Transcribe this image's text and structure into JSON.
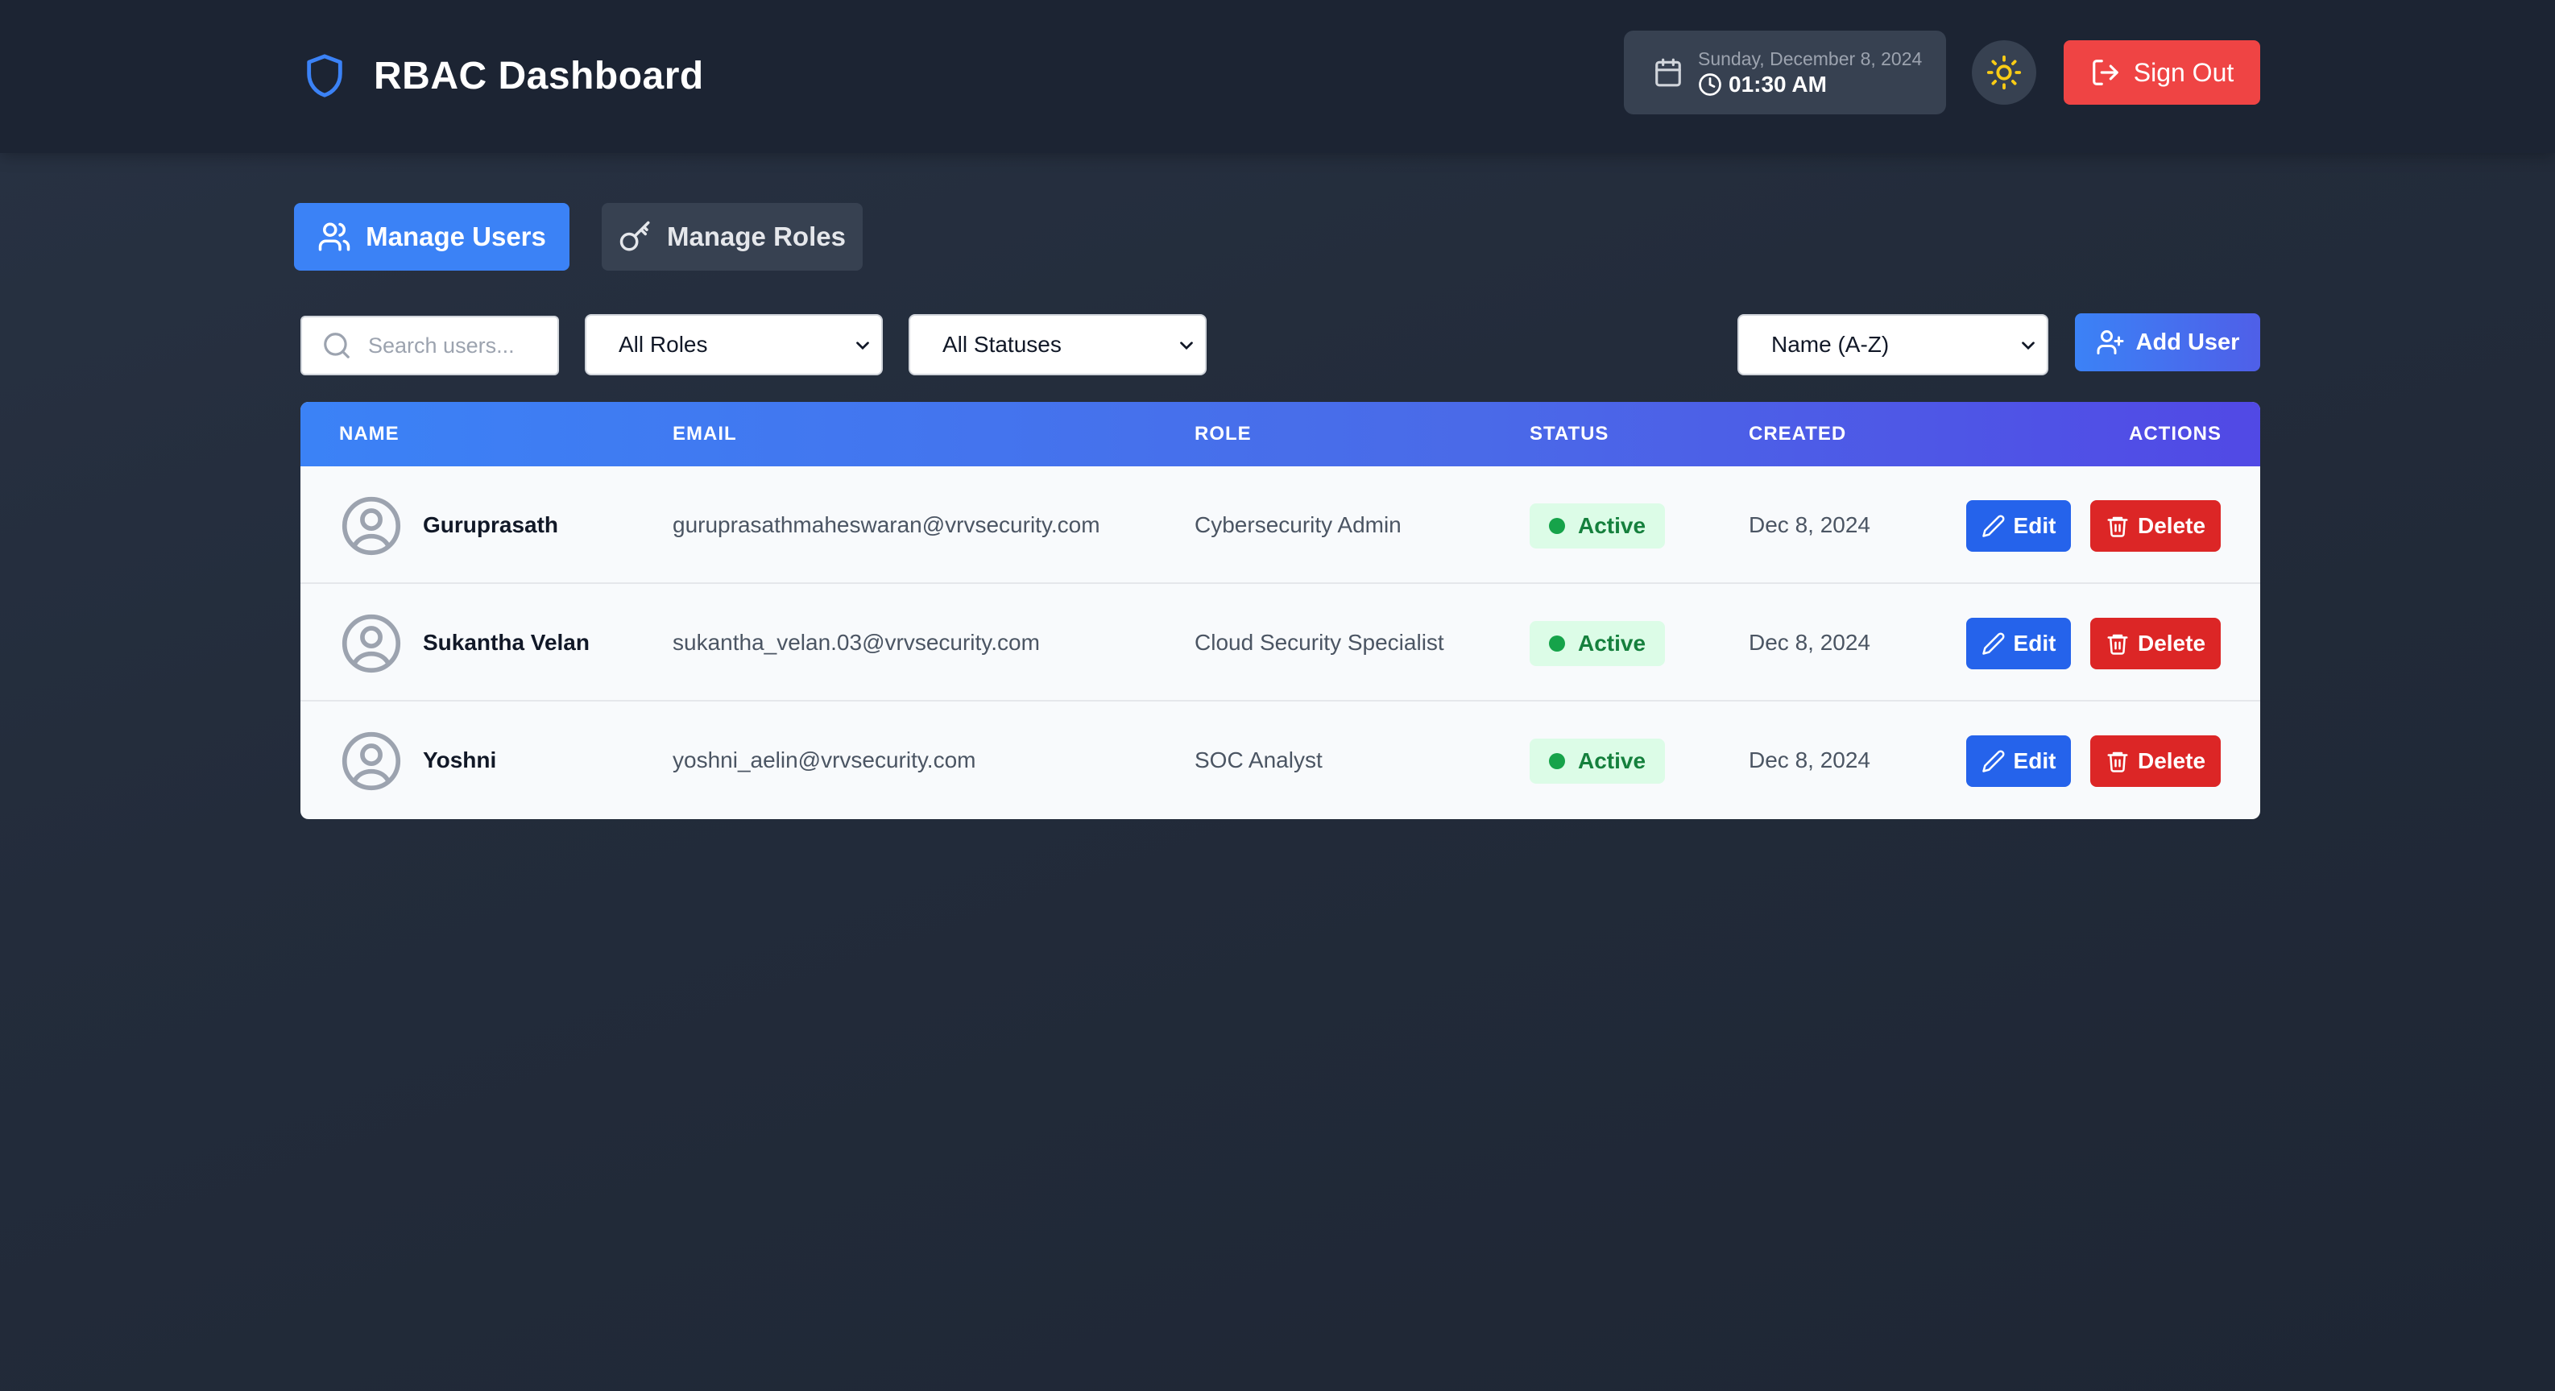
{
  "header": {
    "title": "RBAC Dashboard",
    "date": "Sunday, December 8, 2024",
    "time": "01:30 AM",
    "signout_label": "Sign Out"
  },
  "tabs": [
    {
      "label": "Manage Users",
      "active": true
    },
    {
      "label": "Manage Roles",
      "active": false
    }
  ],
  "filters": {
    "search_placeholder": "Search users...",
    "role_value": "All Roles",
    "status_value": "All Statuses",
    "sort_value": "Name (A-Z)",
    "add_user_label": "Add User"
  },
  "table": {
    "columns": [
      "NAME",
      "EMAIL",
      "ROLE",
      "STATUS",
      "CREATED",
      "ACTIONS"
    ],
    "rows": [
      {
        "name": "Guruprasath",
        "email": "guruprasathmaheswaran@vrvsecurity.com",
        "role": "Cybersecurity Admin",
        "status": "Active",
        "created": "Dec 8, 2024"
      },
      {
        "name": "Sukantha Velan",
        "email": "sukantha_velan.03@vrvsecurity.com",
        "role": "Cloud Security Specialist",
        "status": "Active",
        "created": "Dec 8, 2024"
      },
      {
        "name": "Yoshni",
        "email": "yoshni_aelin@vrvsecurity.com",
        "role": "SOC Analyst",
        "status": "Active",
        "created": "Dec 8, 2024"
      }
    ],
    "edit_label": "Edit",
    "delete_label": "Delete"
  },
  "colors": {
    "accent": "#3b82f6",
    "danger": "#ef4444",
    "success": "#15803d",
    "background": "#232c3b"
  },
  "icons": [
    "shield-icon",
    "calendar-icon",
    "clock-icon",
    "sun-icon",
    "sign-out-icon",
    "users-icon",
    "key-icon",
    "search-icon",
    "chevron-down-icon",
    "user-plus-icon",
    "user-circle-icon",
    "pencil-icon",
    "trash-icon"
  ]
}
